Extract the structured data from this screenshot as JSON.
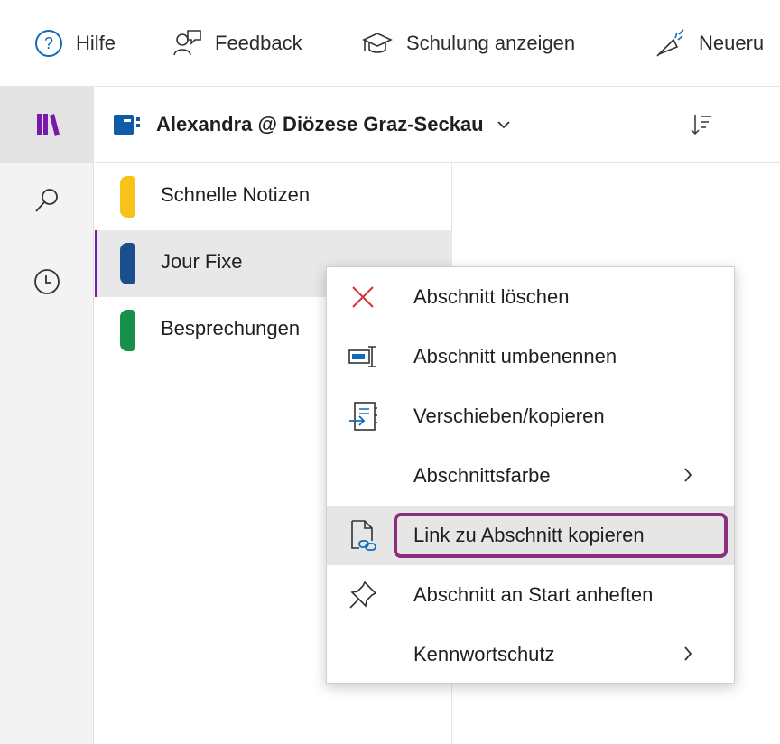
{
  "ribbon": {
    "help_label": "Hilfe",
    "feedback_label": "Feedback",
    "training_label": "Schulung anzeigen",
    "whats_new_label": "Neueru"
  },
  "rail": {
    "items": [
      "notebooks-icon",
      "search-icon",
      "recent-icon"
    ]
  },
  "notebook": {
    "title": "Alexandra @ Diözese Graz-Seckau",
    "icon_color": "#0f5ba7"
  },
  "sections": [
    {
      "label": "Schnelle Notizen",
      "color": "#f8c21a"
    },
    {
      "label": "Jour Fixe",
      "color": "#1b4e8d",
      "selected": true
    },
    {
      "label": "Besprechungen",
      "color": "#17914a"
    }
  ],
  "context_menu": {
    "items": [
      {
        "label": "Abschnitt löschen",
        "icon": "delete-x-icon"
      },
      {
        "label": "Abschnitt umbenennen",
        "icon": "rename-icon"
      },
      {
        "label": "Verschieben/kopieren",
        "icon": "move-copy-icon"
      },
      {
        "label": "Abschnittsfarbe",
        "icon": "",
        "submenu": true
      },
      {
        "label": "Link zu Abschnitt kopieren",
        "icon": "copy-link-icon",
        "highlighted": true
      },
      {
        "label": "Abschnitt an Start anheften",
        "icon": "pin-icon"
      },
      {
        "label": "Kennwortschutz",
        "icon": "",
        "submenu": true
      }
    ]
  },
  "colors": {
    "accent_purple": "#7719aa",
    "highlight_border": "#8c2e80",
    "delete_red": "#d13438",
    "icon_blue": "#0f6cbd"
  }
}
